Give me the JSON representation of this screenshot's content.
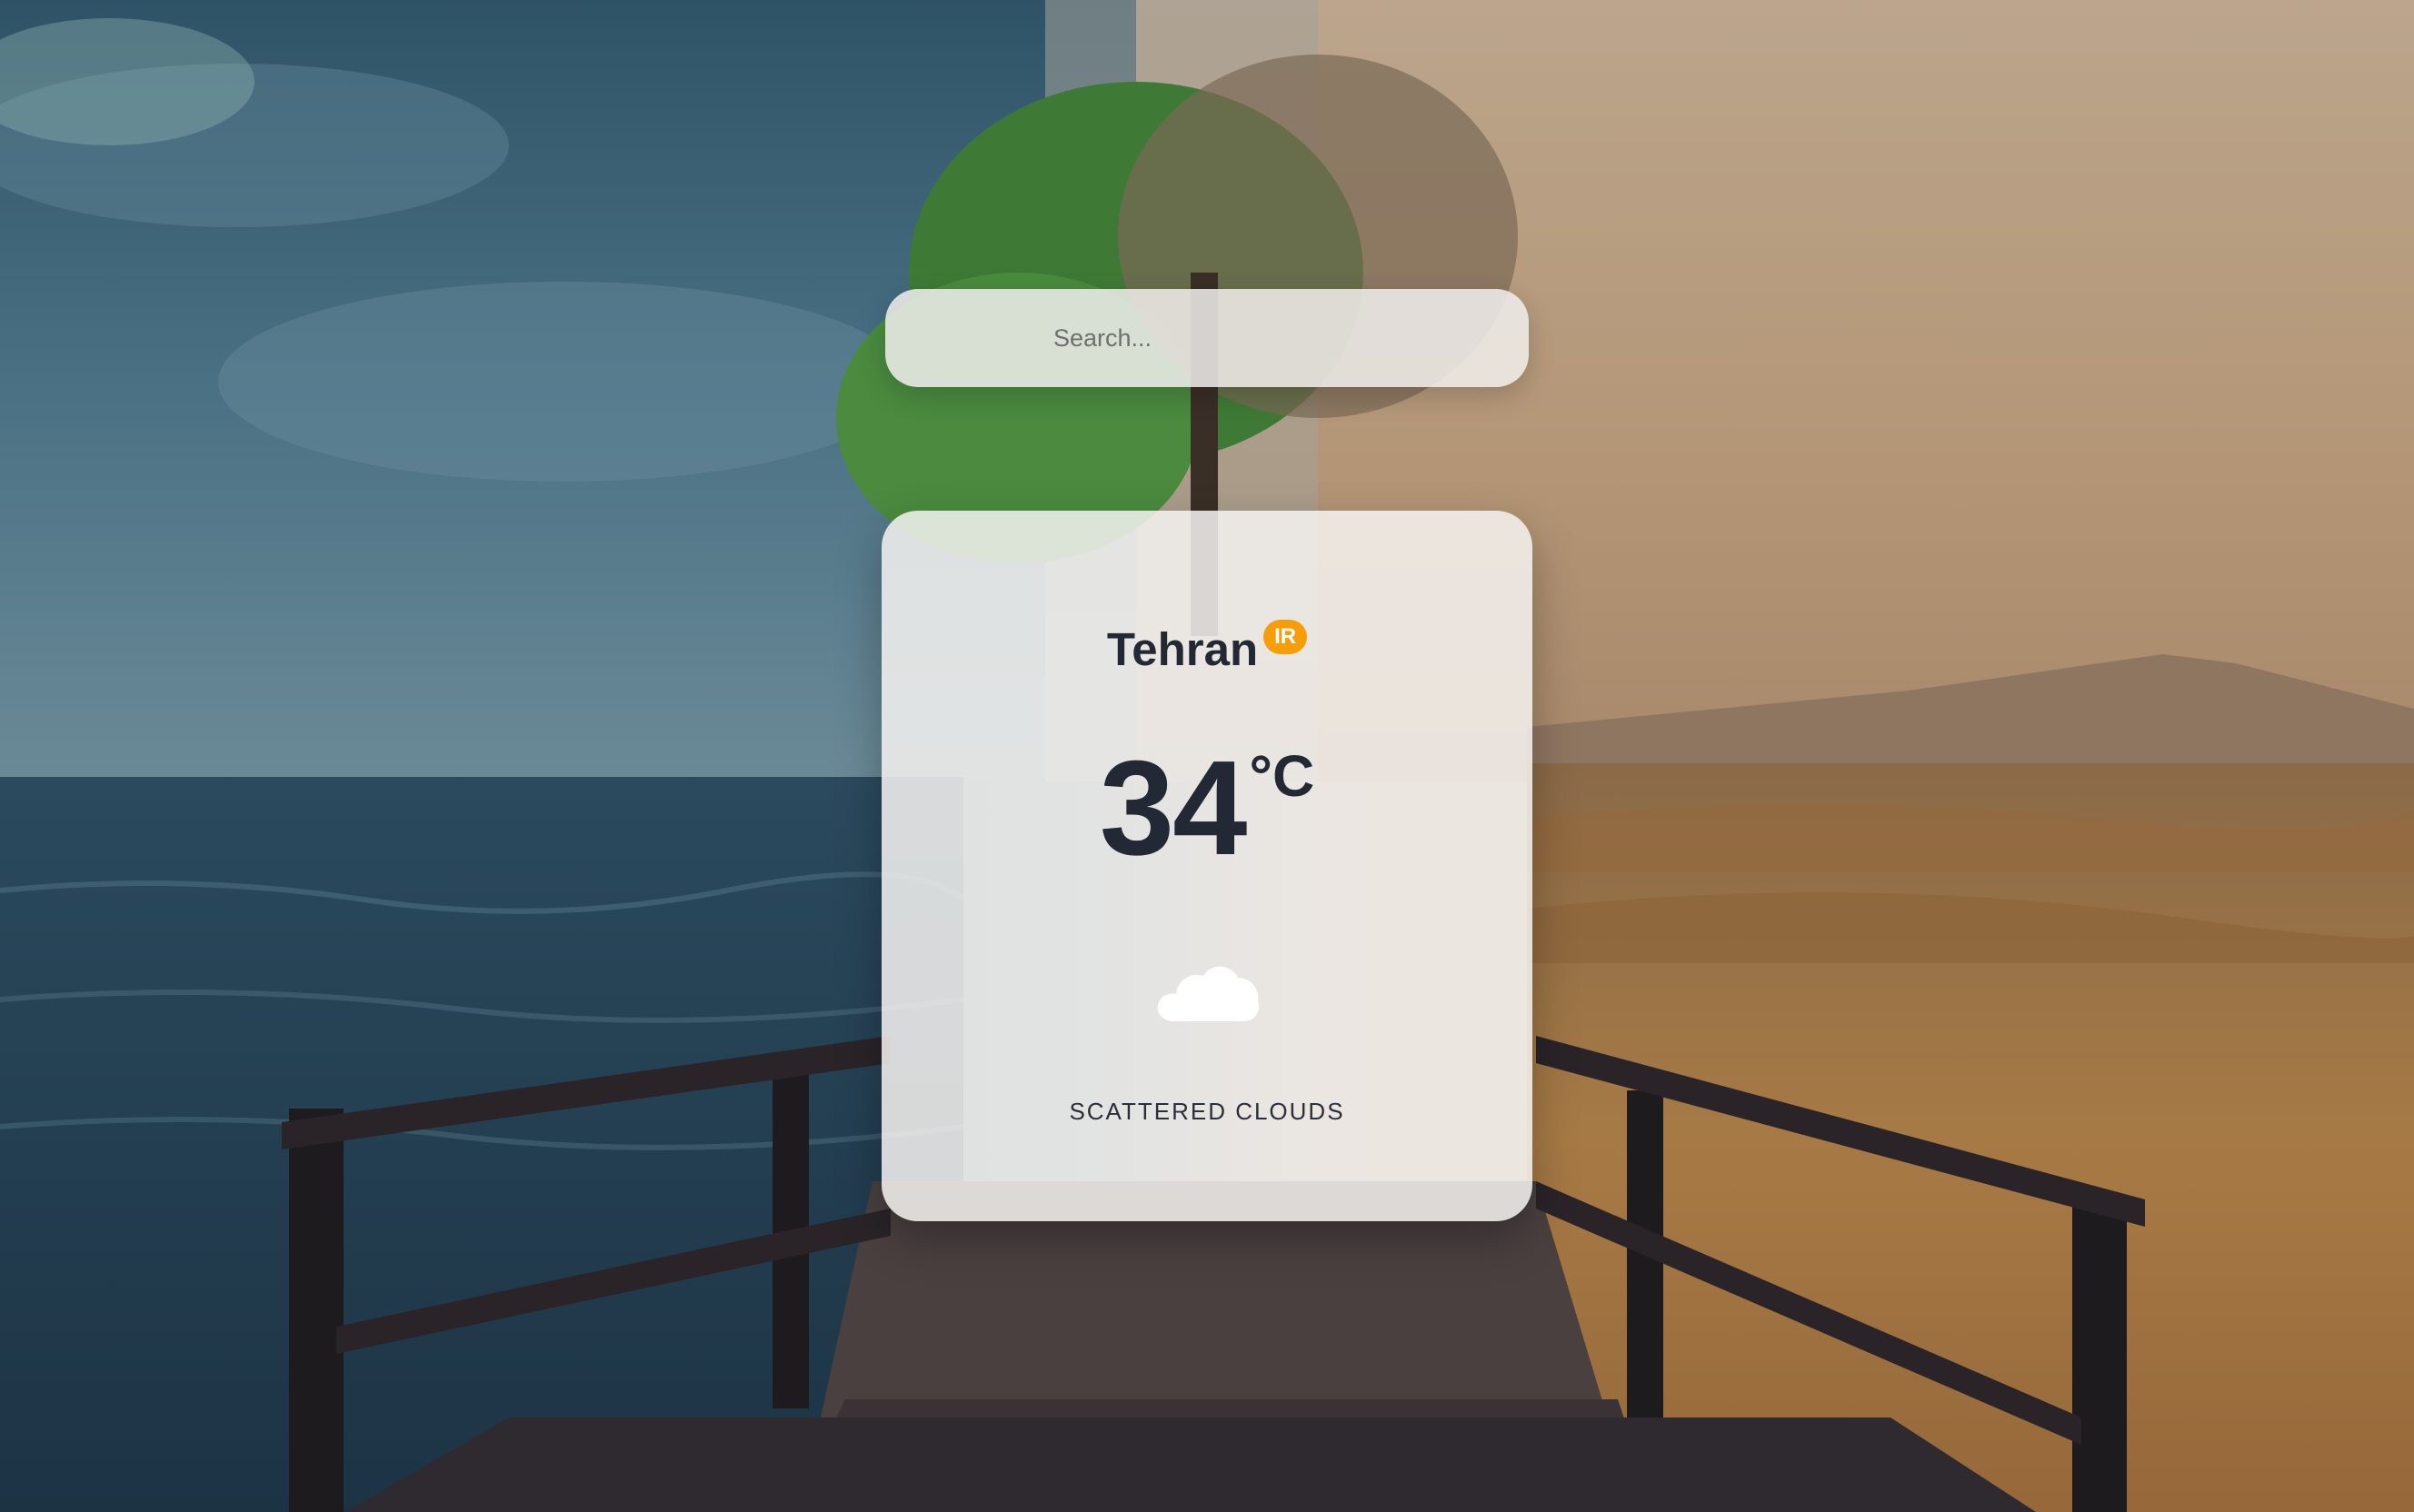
{
  "search": {
    "placeholder": "Search..."
  },
  "weather": {
    "city": "Tehran",
    "country_code": "IR",
    "temperature": "34",
    "unit": "°C",
    "description": "SCATTERED CLOUDS",
    "icon": "cloud-icon"
  },
  "colors": {
    "badge": "#f59d0b",
    "text_dark": "#222834",
    "card_bg": "#f4f2f0"
  }
}
